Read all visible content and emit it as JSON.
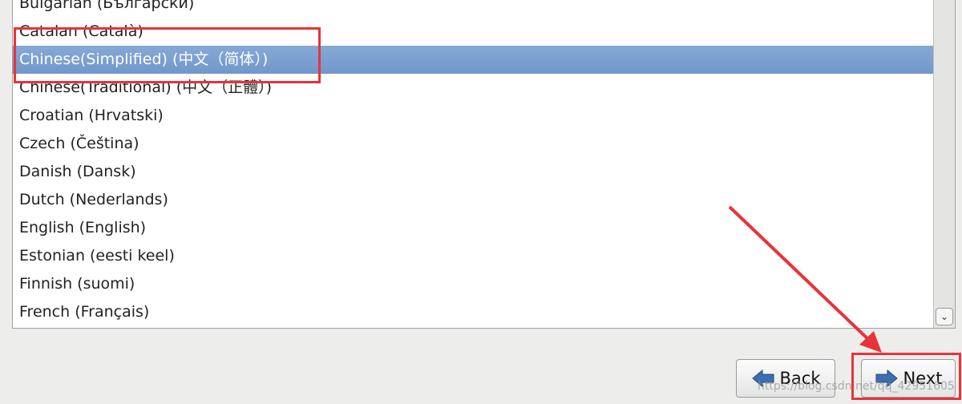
{
  "languages": [
    "Bulgarian (Български)",
    "Catalan (Català)",
    "Chinese(Simplified) (中文（简体）)",
    "Chinese(Traditional) (中文（正體）)",
    "Croatian (Hrvatski)",
    "Czech (Čeština)",
    "Danish (Dansk)",
    "Dutch (Nederlands)",
    "English (English)",
    "Estonian (eesti keel)",
    "Finnish (suomi)",
    "French (Français)"
  ],
  "selected_index": 2,
  "buttons": {
    "back": "Back",
    "next": "Next"
  },
  "watermark": "https://blog.csdn.net/qq_42951605",
  "colors": {
    "selection": "#7a9fd0",
    "annotation": "#e8333a"
  }
}
